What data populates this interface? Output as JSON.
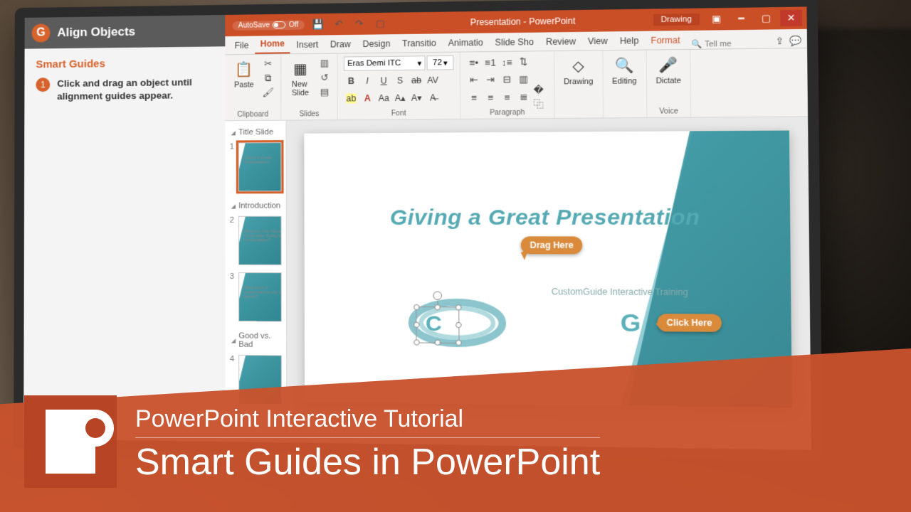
{
  "tutorial": {
    "header_title": "Align Objects",
    "section_title": "Smart Guides",
    "step_number": "1",
    "step_text": "Click and drag an object until alignment guides appear."
  },
  "titlebar": {
    "autosave_label": "AutoSave",
    "autosave_state": "Off",
    "doc_title": "Presentation - PowerPoint",
    "mode": "Drawing"
  },
  "tabs": {
    "file": "File",
    "home": "Home",
    "insert": "Insert",
    "draw": "Draw",
    "design": "Design",
    "transitions": "Transitio",
    "animations": "Animatio",
    "slideshow": "Slide Sho",
    "review": "Review",
    "view": "View",
    "help": "Help",
    "format": "Format",
    "tellme": "Tell me"
  },
  "ribbon": {
    "clipboard": {
      "label": "Clipboard",
      "paste": "Paste"
    },
    "slides": {
      "label": "Slides",
      "new_slide": "New\nSlide"
    },
    "font": {
      "label": "Font",
      "name": "Eras Demi ITC",
      "size": "72"
    },
    "paragraph": {
      "label": "Paragraph"
    },
    "drawing": {
      "label": "Drawing",
      "btn": "Drawing"
    },
    "editing": {
      "label": "Editing",
      "btn": "Editing"
    },
    "voice": {
      "label": "Voice",
      "dictate": "Dictate"
    }
  },
  "outline": {
    "sections": [
      {
        "title": "Title Slide",
        "slides": [
          1
        ]
      },
      {
        "title": "Introduction",
        "slides": [
          2,
          3
        ]
      },
      {
        "title": "Good vs. Bad",
        "slides": [
          4
        ]
      }
    ]
  },
  "slide": {
    "title": "Giving a Great Presentation",
    "subtitle": "CustomGuide Interactive Training",
    "letter_c": "C",
    "letter_g": "G",
    "callout_drag": "Drag Here",
    "callout_click": "Click Here"
  },
  "banner": {
    "line1": "PowerPoint Interactive Tutorial",
    "line2": "Smart Guides in PowerPoint"
  },
  "colors": {
    "accent": "#ca4e26",
    "tutorial_accent": "#d7622c",
    "callout": "#d98a3a",
    "slide_teal": "#54a9b2"
  }
}
